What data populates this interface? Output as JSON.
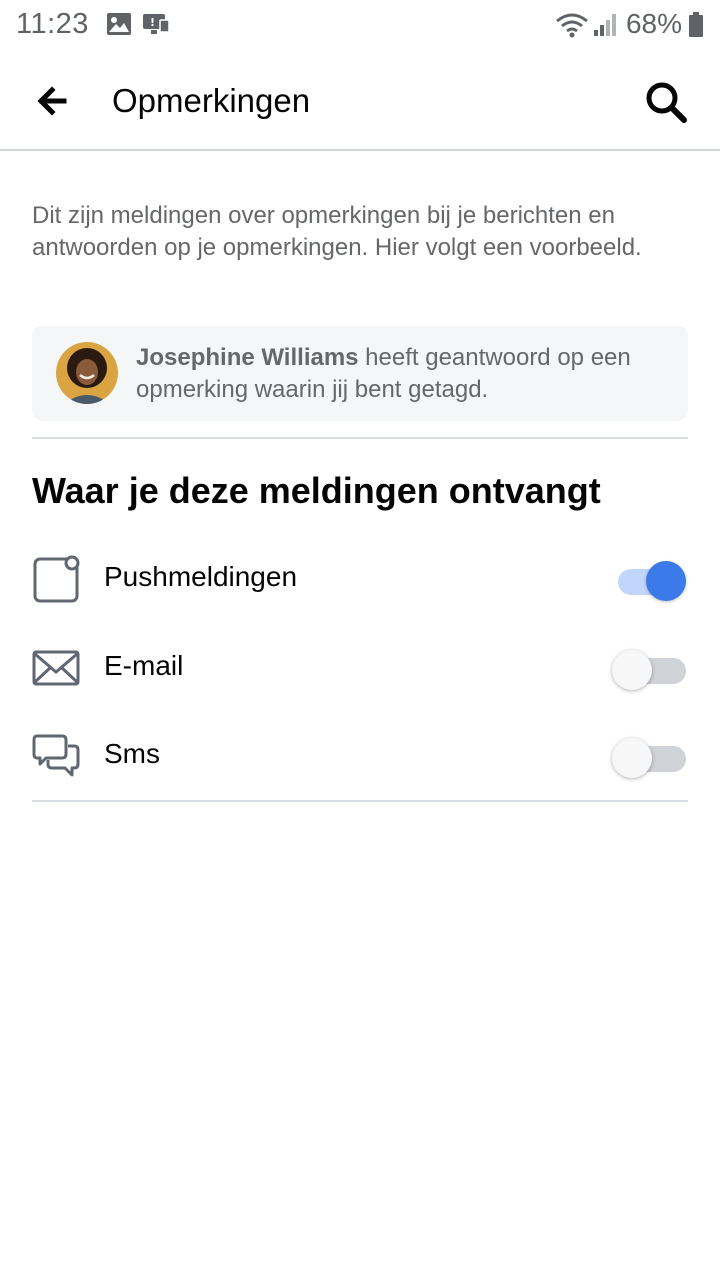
{
  "status_bar": {
    "time": "11:23",
    "battery": "68%",
    "icons": [
      "image-icon",
      "cast-icon",
      "wifi-icon",
      "signal-icon",
      "battery-icon"
    ]
  },
  "header": {
    "title": "Opmerkingen",
    "back_icon": "arrow-left-icon",
    "search_icon": "search-icon"
  },
  "description": "Dit zijn meldingen over opmerkingen bij je berichten en antwoorden op je opmerkingen. Hier volgt een voorbeeld.",
  "preview": {
    "name": "Josephine Williams",
    "text": " heeft geantwoord op een opmerking waarin jij bent getagd."
  },
  "section_title": "Waar je deze meldingen ontvangt",
  "channels": [
    {
      "label": "Pushmeldingen",
      "icon": "phone-notification-icon",
      "enabled": true
    },
    {
      "label": "E-mail",
      "icon": "envelope-icon",
      "enabled": false
    },
    {
      "label": "Sms",
      "icon": "chat-bubbles-icon",
      "enabled": false
    }
  ],
  "colors": {
    "accent": "#3b7ae8",
    "accent_track": "#c2d6fb",
    "secondary_text": "#65676b",
    "card_bg": "#f5f6f7"
  }
}
